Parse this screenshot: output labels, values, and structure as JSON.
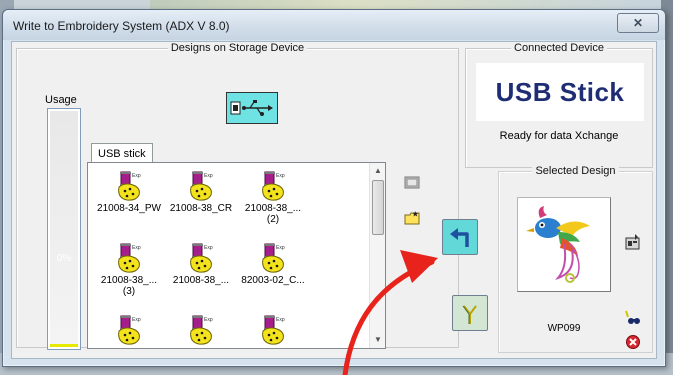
{
  "window": {
    "title": "Write to Embroidery System (ADX V 8.0)",
    "close_glyph": "✕"
  },
  "storage": {
    "group_title": "Designs on Storage Device",
    "usage_label": "Usage",
    "usage_percent_text": "0%",
    "usage_fraction": 0.01,
    "device_icon": "usb-device-icon",
    "tab_label": "USB stick",
    "files": [
      {
        "name": "21008-34_PW"
      },
      {
        "name": "21008-38_CR"
      },
      {
        "name": "21008-38_...",
        "sub": "(2)"
      },
      {
        "name": "21008-38_...",
        "sub": "(3)"
      },
      {
        "name": "21008-38_..."
      },
      {
        "name": "82003-02_C..."
      },
      {
        "name": ""
      },
      {
        "name": ""
      },
      {
        "name": ""
      }
    ]
  },
  "connected": {
    "group_title": "Connected Device",
    "device_name": "USB Stick",
    "status": "Ready for data Xchange"
  },
  "selected": {
    "group_title": "Selected Design",
    "design_name": "WP099"
  },
  "colors": {
    "accent_cyan": "#63d8d8",
    "usb_brand": "#1f2e74",
    "annotation_red": "#e8231c"
  }
}
